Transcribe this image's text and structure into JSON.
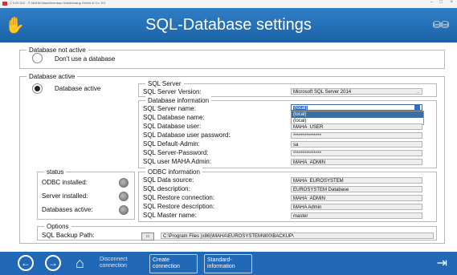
{
  "window": {
    "title": "V 9.00.312 - © MAHA Maschinenbau Haldenwang GmbH & Co. KG",
    "minimize": "–",
    "maximize": "□",
    "close": "×"
  },
  "header": {
    "title": "SQL-Database settings"
  },
  "no_db": {
    "legend": "Database not active",
    "option": "Don't use a database",
    "selected": false
  },
  "db_active": {
    "legend": "Database active",
    "option": "Database active",
    "selected": true
  },
  "sql_server": {
    "legend": "SQL Server",
    "version_label": "SQL Server Version:",
    "version_value": "Microsoft SQL Server 2014"
  },
  "db_info": {
    "legend": "Database information",
    "rows": [
      {
        "label": "SQL Server name:",
        "value": "(local)"
      },
      {
        "label": "SQL Database name:",
        "value": ""
      },
      {
        "label": "SQL Database user:",
        "value": "MAHA_USER"
      },
      {
        "label": "SQL Database user password:",
        "value": "***************"
      },
      {
        "label": "SQL Default-Admin:",
        "value": "sa"
      },
      {
        "label": "SQL Server-Password:",
        "value": "***************"
      },
      {
        "label": "SQL user MAHA Admin:",
        "value": "MAHA_ADMIN"
      }
    ],
    "dropdown_options": [
      "(local)",
      "(local)"
    ]
  },
  "status": {
    "legend": "status",
    "items": [
      {
        "label": "ODBC installed:",
        "color": "#8a8a8a"
      },
      {
        "label": "Server installed:",
        "color": "#8a8a8a"
      },
      {
        "label": "Databases active:",
        "color": "#8a8a8a"
      }
    ]
  },
  "odbc": {
    "legend": "ODBC information",
    "rows": [
      {
        "label": "SQL Data source:",
        "value": "MAHA_EUROSYSTEM"
      },
      {
        "label": "SQL description:",
        "value": "EUROSYSTEM Database"
      },
      {
        "label": "SQL Restore connection:",
        "value": "MAHA_ADMIN"
      },
      {
        "label": "SQL Restore description:",
        "value": "MAHA Admin"
      },
      {
        "label": "SQL Master name:",
        "value": "master"
      }
    ]
  },
  "options": {
    "legend": "Options",
    "backup_label": "SQL Backup Path:",
    "backup_path": "C:\\Program Files (x86)\\MAHA\\EUROSYSTEM\\800\\BACKUP\\"
  },
  "bottom": {
    "back_icon": "arrow-left-icon",
    "forward_icon": "arrow-right-icon",
    "home_icon": "home-icon",
    "disconnect_l1": "Disconnect",
    "disconnect_l2": "connection",
    "create_l1": "Create",
    "create_l2": "connection",
    "standard_l1": "Standard-",
    "standard_l2": "information",
    "exit_icon": "exit-icon"
  },
  "colors": {
    "header_blue": "#1f6cb5",
    "bottom_blue": "#2168b6",
    "selection_blue": "#2f6ec6"
  }
}
